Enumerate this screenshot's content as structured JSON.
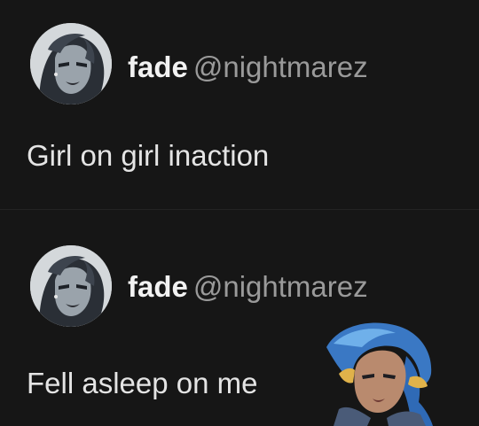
{
  "posts": [
    {
      "author": {
        "display_name": "fade",
        "handle": "@nightmarez",
        "avatar_icon": "avatar-icon"
      },
      "text": "Girl on girl inaction"
    },
    {
      "author": {
        "display_name": "fade",
        "handle": "@nightmarez",
        "avatar_icon": "avatar-icon"
      },
      "text": "Fell asleep on me",
      "sticker_icon": "character-sticker-icon"
    }
  ],
  "colors": {
    "background": "#161616",
    "text": "#e4e4e4",
    "handle": "#9a9a9a",
    "divider": "#242424"
  }
}
